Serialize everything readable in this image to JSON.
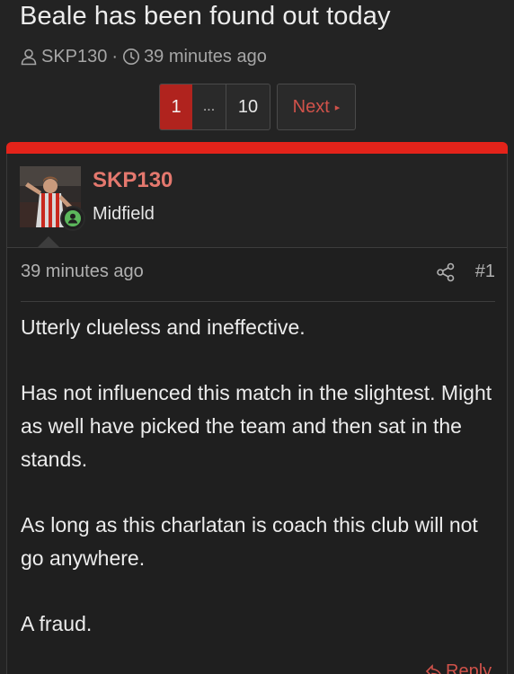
{
  "thread": {
    "title": "Beale has been found out today",
    "author": "SKP130",
    "separator": "·",
    "time": "39 minutes ago"
  },
  "pagination": {
    "current": "1",
    "ellipsis": "...",
    "last": "10",
    "next_label": "Next",
    "next_glyph": "▸"
  },
  "post": {
    "username": "SKP130",
    "user_title": "Midfield",
    "time": "39 minutes ago",
    "number": "#1",
    "paragraphs": [
      "Utterly clueless and ineffective.",
      "Has not influenced this match in the slightest. Might as well have picked the team and then sat in the stands.",
      "As long as this charlatan is coach this club will not go anywhere.",
      "A fraud."
    ],
    "reply_label": "Reply"
  },
  "colors": {
    "accent_bar": "#e4231a",
    "current_page": "#b0231e",
    "link": "#d0524a",
    "username": "#e4786e",
    "online": "#5cb85c",
    "background": "#232323"
  },
  "icons": {
    "author": "user-icon",
    "time": "clock-icon",
    "share": "share-icon",
    "online": "online-user-icon",
    "reply": "reply-icon"
  }
}
